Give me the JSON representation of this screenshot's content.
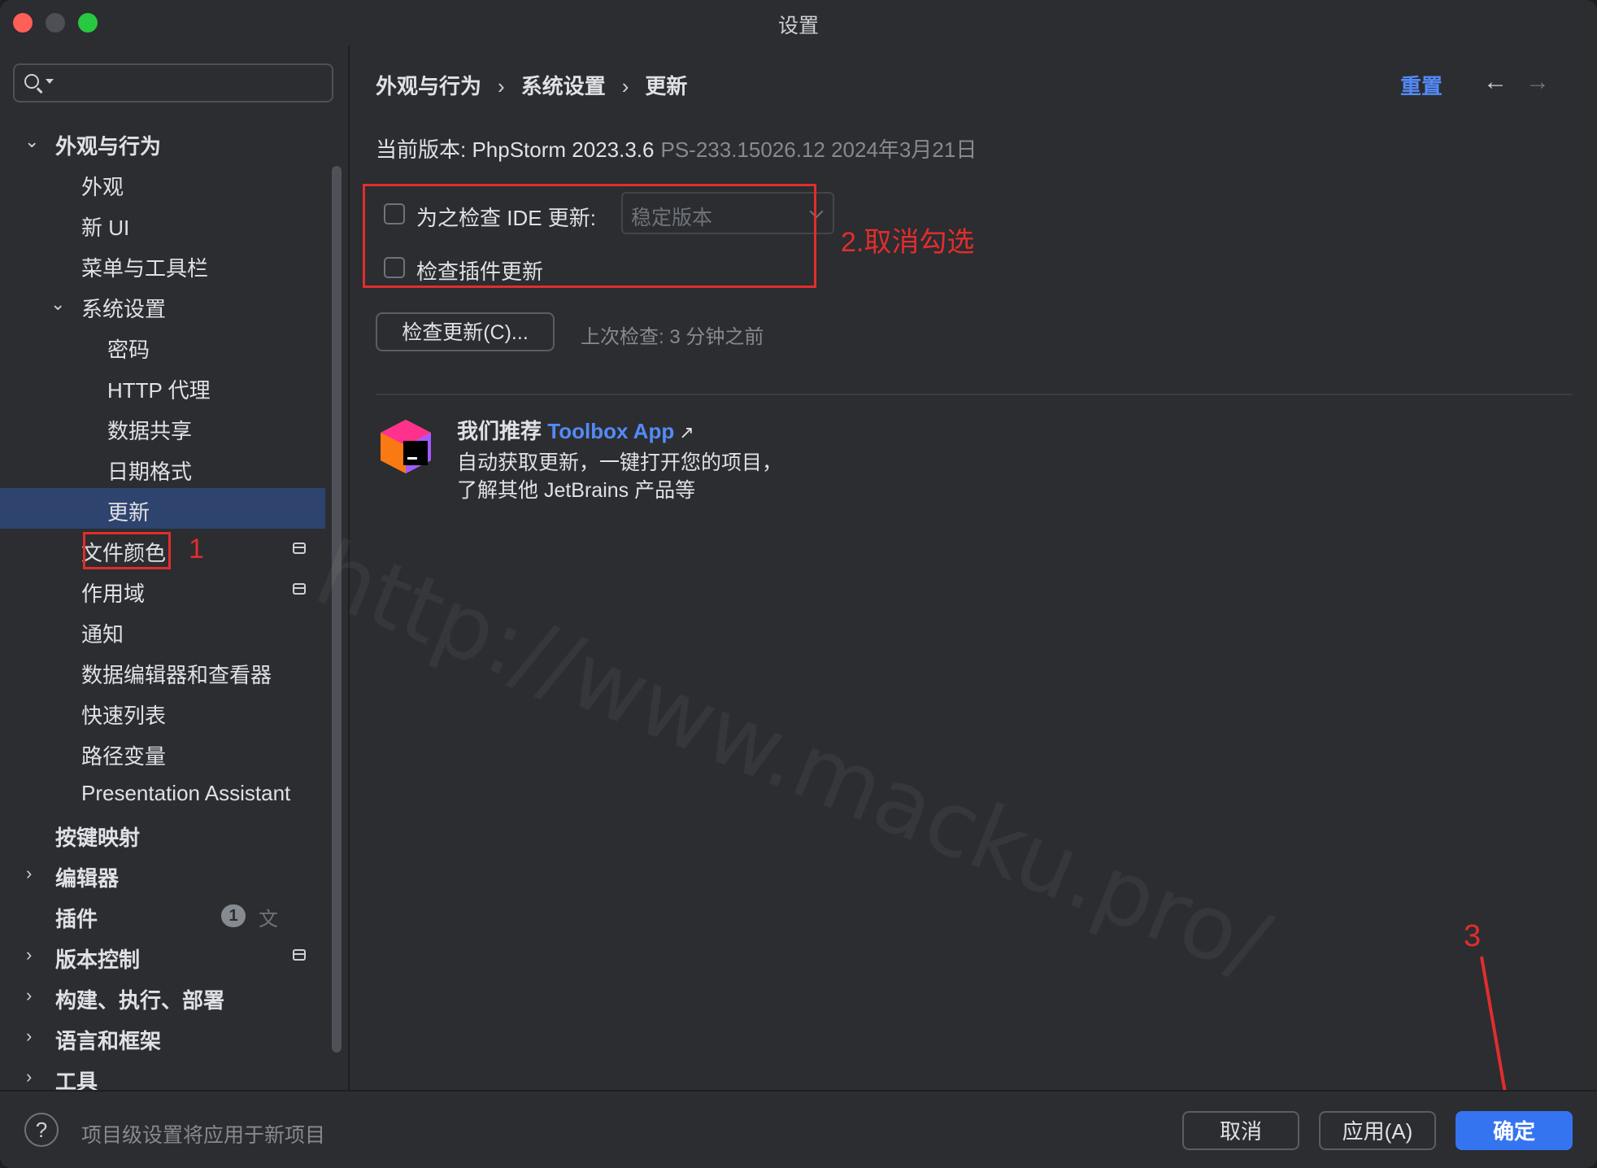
{
  "window": {
    "title": "设置"
  },
  "search": {
    "value": "",
    "placeholder": ""
  },
  "sidebar": {
    "items": [
      {
        "label": "外观与行为"
      },
      {
        "label": "外观"
      },
      {
        "label": "新 UI"
      },
      {
        "label": "菜单与工具栏"
      },
      {
        "label": "系统设置"
      },
      {
        "label": "密码"
      },
      {
        "label": "HTTP 代理"
      },
      {
        "label": "数据共享"
      },
      {
        "label": "日期格式"
      },
      {
        "label": "更新"
      },
      {
        "label": "文件颜色"
      },
      {
        "label": "作用域"
      },
      {
        "label": "通知"
      },
      {
        "label": "数据编辑器和查看器"
      },
      {
        "label": "快速列表"
      },
      {
        "label": "路径变量"
      },
      {
        "label": "Presentation Assistant"
      },
      {
        "label": "按键映射"
      },
      {
        "label": "编辑器"
      },
      {
        "label": "插件",
        "badge": "1"
      },
      {
        "label": "版本控制"
      },
      {
        "label": "构建、执行、部署"
      },
      {
        "label": "语言和框架"
      },
      {
        "label": "工具"
      }
    ]
  },
  "header": {
    "breadcrumb": [
      "外观与行为",
      "系统设置",
      "更新"
    ],
    "reset_label": "重置"
  },
  "content": {
    "version_label": "当前版本: PhpStorm 2023.3.6",
    "build_info": "PS-233.15026.12 2024年3月21日",
    "check_ide_label": "为之检查 IDE 更新:",
    "channel_value": "稳定版本",
    "check_plugins_label": "检查插件更新",
    "check_now_button": "检查更新(C)...",
    "last_check": "上次检查: 3 分钟之前",
    "promo_prefix": "我们推荐",
    "promo_link": "Toolbox App",
    "promo_line1": "自动获取更新，一键打开您的项目，",
    "promo_line2": "了解其他 JetBrains 产品等"
  },
  "annotations": {
    "step1": "1",
    "step2": "2.取消勾选",
    "step3": "3"
  },
  "watermark": "http://www.macku.pro/",
  "footer": {
    "note": "项目级设置将应用于新项目",
    "cancel": "取消",
    "apply": "应用(A)",
    "ok": "确定"
  },
  "colors": {
    "accent": "#3574f0",
    "link": "#548af7",
    "selection": "#2e436e",
    "annotation": "#e22d2d"
  }
}
